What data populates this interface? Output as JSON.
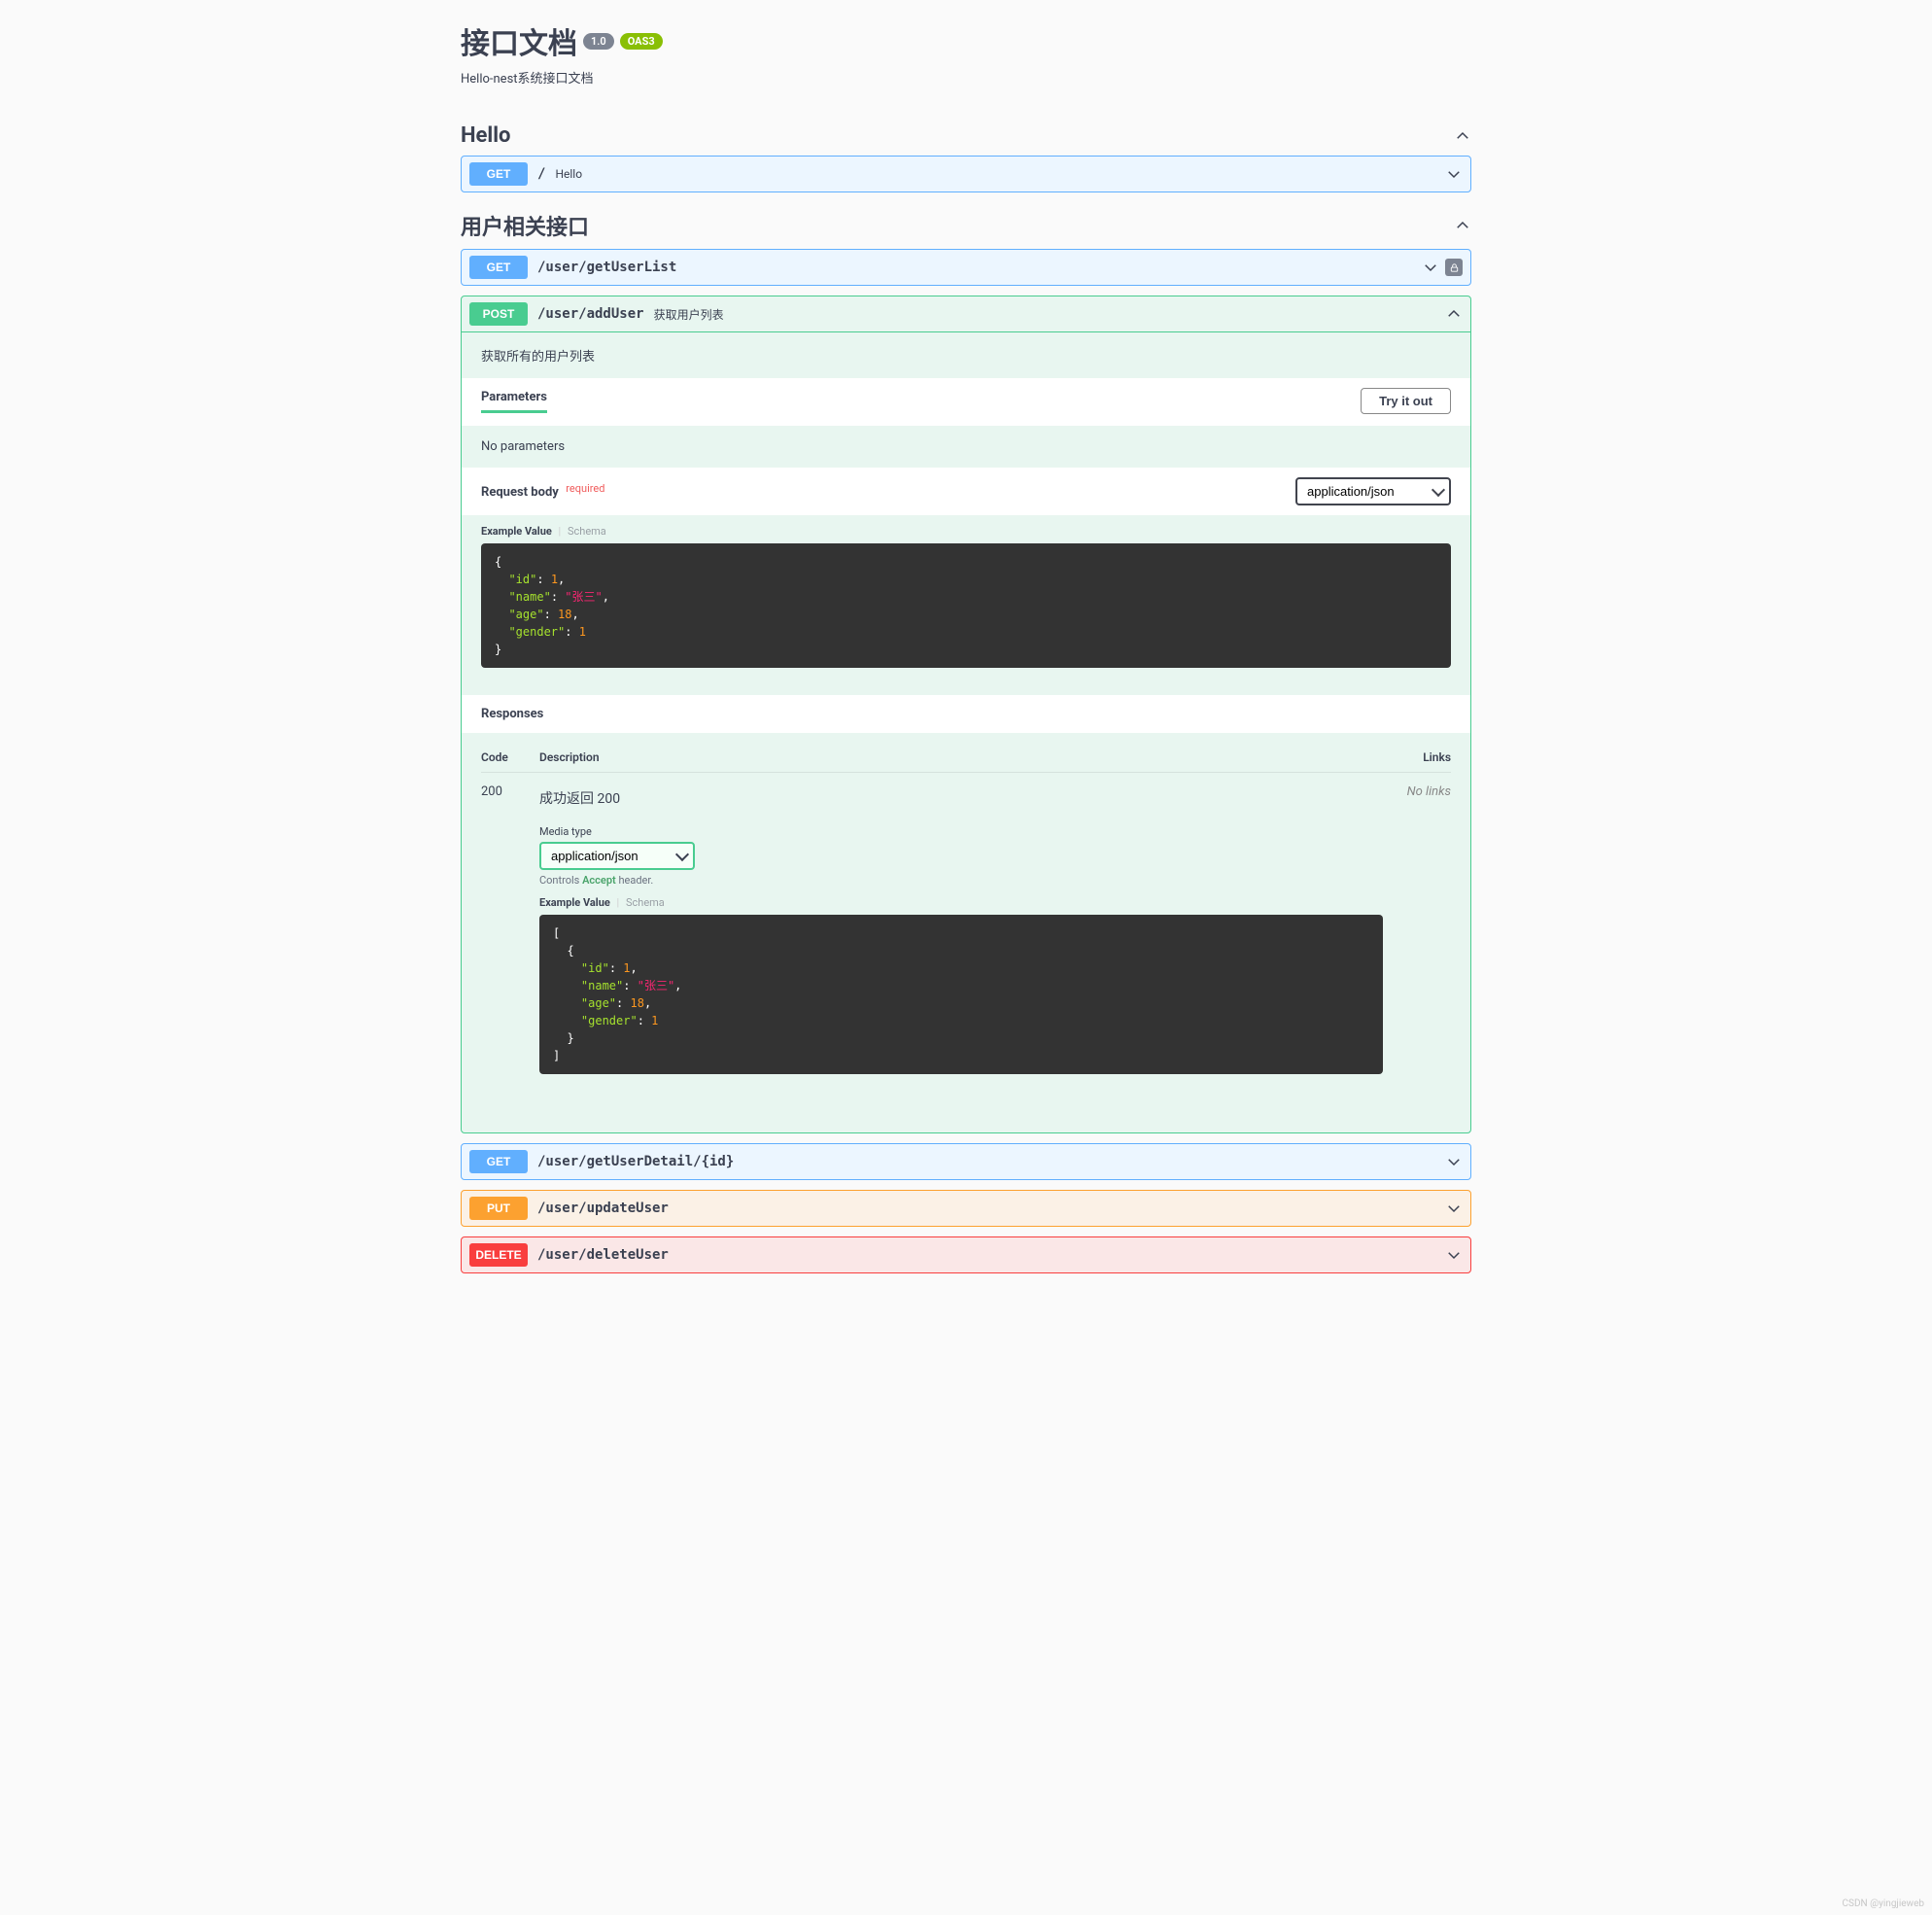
{
  "header": {
    "title": "接口文档",
    "version": "1.0",
    "oas_badge": "OAS3",
    "description": "Hello-nest系统接口文档"
  },
  "tags": [
    {
      "name": "Hello"
    },
    {
      "name": "用户相关接口"
    }
  ],
  "ops": {
    "helloGet": {
      "method": "GET",
      "path": "/",
      "summary": "Hello"
    },
    "getUserList": {
      "method": "GET",
      "path": "/user/getUserList"
    },
    "addUser": {
      "method": "POST",
      "path": "/user/addUser",
      "summary": "获取用户列表",
      "body_desc": "获取所有的用户列表"
    },
    "getUserDetail": {
      "method": "GET",
      "path": "/user/getUserDetail/{id}"
    },
    "updateUser": {
      "method": "PUT",
      "path": "/user/updateUser"
    },
    "deleteUser": {
      "method": "DELETE",
      "path": "/user/deleteUser"
    }
  },
  "labels": {
    "parameters": "Parameters",
    "try_it_out": "Try it out",
    "no_parameters": "No parameters",
    "request_body": "Request body",
    "required": "required",
    "content_type": "application/json",
    "example_value": "Example Value",
    "schema": "Schema",
    "responses": "Responses",
    "code": "Code",
    "description": "Description",
    "links": "Links",
    "no_links": "No links",
    "media_type": "Media type",
    "accept_note_prefix": "Controls ",
    "accept_word": "Accept",
    "accept_note_suffix": " header."
  },
  "request_example": {
    "id": 1,
    "name": "张三",
    "age": 18,
    "gender": 1
  },
  "responses": {
    "200": {
      "code": "200",
      "description": "成功返回 200",
      "media_type": "application/json",
      "example": [
        {
          "id": 1,
          "name": "张三",
          "age": 18,
          "gender": 1
        }
      ]
    }
  },
  "watermark": "CSDN @yingjieweb"
}
